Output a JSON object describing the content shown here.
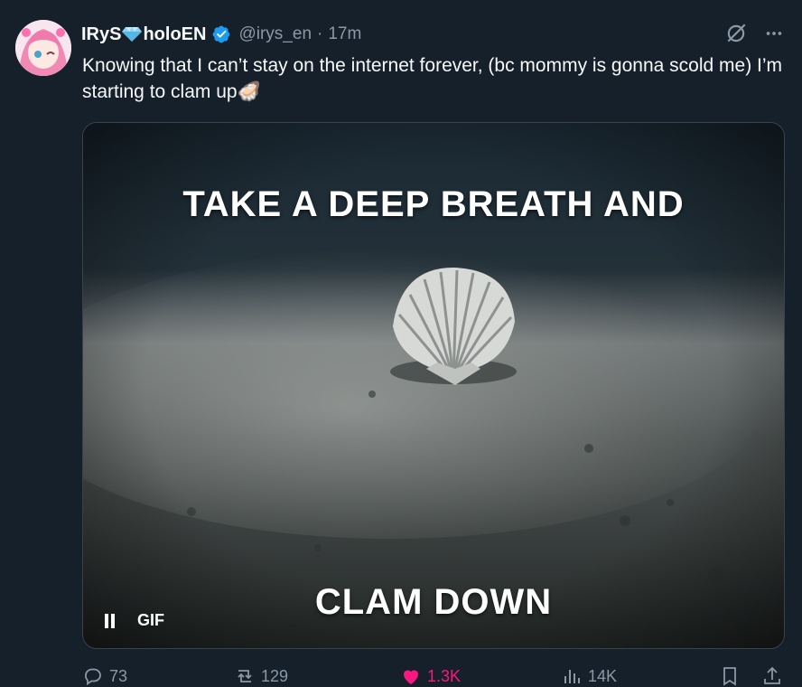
{
  "tweet": {
    "display_name_left": "IRyS",
    "display_name_right": "holoEN",
    "handle": "@irys_en",
    "separator": "·",
    "time": "17m",
    "text": "Knowing that I can’t stay on the internet forever, (bc mommy is gonna scold me) I’m starting to clam up",
    "text_emoji": "🦪"
  },
  "media": {
    "caption_top": "TAKE A DEEP BREATH AND",
    "caption_bottom": "CLAM DOWN",
    "gif_badge": "GIF",
    "playback_state": "playing"
  },
  "actions": {
    "replies": "73",
    "reposts": "129",
    "likes": "1.3K",
    "views": "14K"
  },
  "colors": {
    "background": "#15202b",
    "text": "#f7f9f9",
    "muted": "#8b98a5",
    "verified": "#1d9bf0",
    "like": "#f91880"
  },
  "icons": {
    "verified": "verified-badge-icon",
    "grok": "grok-icon",
    "more": "more-icon",
    "reply": "reply-icon",
    "repost": "repost-icon",
    "like": "heart-icon",
    "views": "views-icon",
    "bookmark": "bookmark-icon",
    "share": "share-icon"
  }
}
